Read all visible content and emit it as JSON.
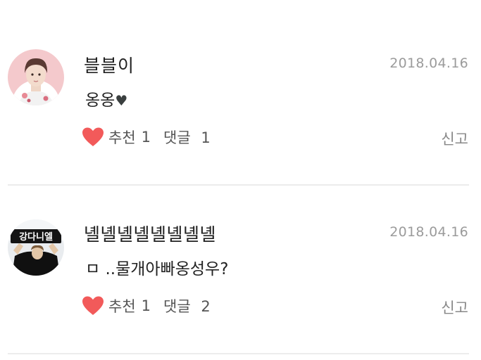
{
  "comments": [
    {
      "username": "블블이",
      "date": "2018.04.16",
      "text": "옹옹",
      "text_emoji": "♥",
      "like_label": "추천",
      "like_count": "1",
      "reply_label": "댓글",
      "reply_count": "1",
      "report_label": "신고"
    },
    {
      "username": "녤녤녤녤녤녤녤녤",
      "date": "2018.04.16",
      "text": "ㅁ ..물개아빠옹성우?",
      "like_label": "추천",
      "like_count": "1",
      "reply_label": "댓글",
      "reply_count": "2",
      "report_label": "신고"
    }
  ],
  "avatar2_sign_text": "강다니엘",
  "colors": {
    "heart": "#f25a5a",
    "date": "#9b9b9b",
    "divider": "#ececec"
  },
  "icons": {
    "like": "heart-icon",
    "emoji": "heart-emoji-icon"
  }
}
